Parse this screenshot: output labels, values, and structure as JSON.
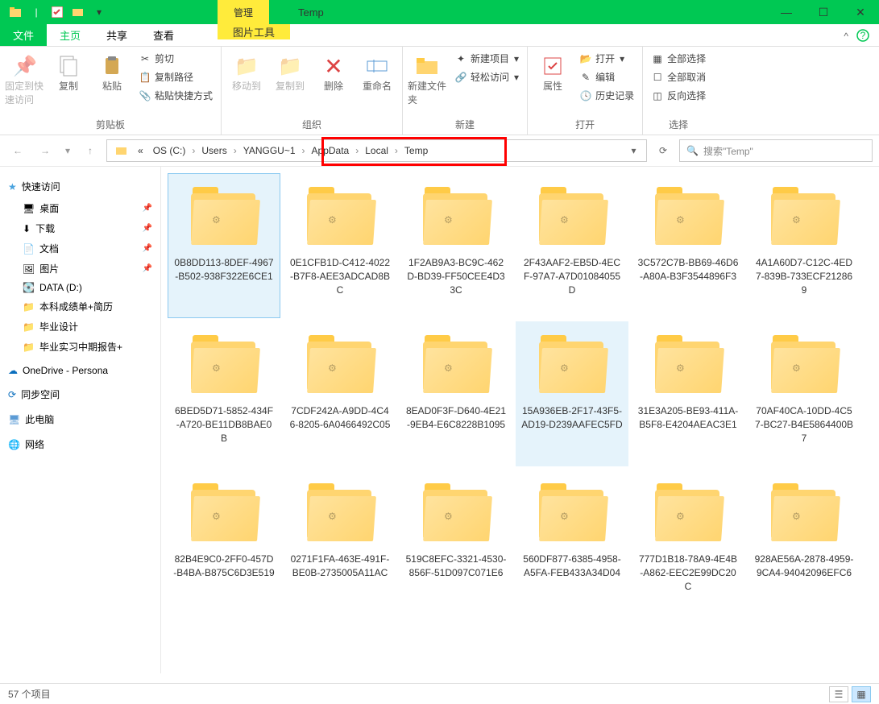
{
  "title": {
    "manage": "管理",
    "window": "Temp"
  },
  "tabs": {
    "file": "文件",
    "home": "主页",
    "share": "共享",
    "view": "查看",
    "pictool": "图片工具"
  },
  "ribbon": {
    "clipboard": {
      "pin": "固定到快速访问",
      "copy": "复制",
      "paste": "粘贴",
      "cut": "剪切",
      "copypath": "复制路径",
      "pastesc": "粘贴快捷方式",
      "label": "剪贴板"
    },
    "organize": {
      "moveto": "移动到",
      "copyto": "复制到",
      "delete": "删除",
      "rename": "重命名",
      "label": "组织"
    },
    "new": {
      "newfolder": "新建文件夹",
      "newitem": "新建项目",
      "easyaccess": "轻松访问",
      "label": "新建"
    },
    "open": {
      "properties": "属性",
      "open": "打开",
      "edit": "编辑",
      "history": "历史记录",
      "label": "打开"
    },
    "select": {
      "selectall": "全部选择",
      "selectnone": "全部取消",
      "invert": "反向选择",
      "label": "选择"
    }
  },
  "breadcrumbs": [
    "OS (C:)",
    "Users",
    "YANGGU~1",
    "AppData",
    "Local",
    "Temp"
  ],
  "search": {
    "placeholder": "搜索\"Temp\""
  },
  "nav": {
    "quick": "快速访问",
    "items": [
      {
        "label": "桌面",
        "pin": true
      },
      {
        "label": "下载",
        "pin": true
      },
      {
        "label": "文档",
        "pin": true
      },
      {
        "label": "图片",
        "pin": true
      },
      {
        "label": "DATA (D:)"
      },
      {
        "label": "本科成绩单+简历"
      },
      {
        "label": "毕业设计"
      },
      {
        "label": "毕业实习中期报告+"
      }
    ],
    "onedrive": "OneDrive - Persona",
    "sync": "同步空间",
    "pc": "此电脑",
    "network": "网络"
  },
  "folders": [
    {
      "name": "0B8DD113-8DEF-4967-B502-938F322E6CE1",
      "sel": true
    },
    {
      "name": "0E1CFB1D-C412-4022-B7F8-AEE3ADCAD8BC"
    },
    {
      "name": "1F2AB9A3-BC9C-462D-BD39-FF50CEE4D33C"
    },
    {
      "name": "2F43AAF2-EB5D-4ECF-97A7-A7D01084055D"
    },
    {
      "name": "3C572C7B-BB69-46D6-A80A-B3F3544896F3"
    },
    {
      "name": "4A1A60D7-C12C-4ED7-839B-733ECF212869"
    },
    {
      "name": "6BED5D71-5852-434F-A720-BE11DB8BAE0B"
    },
    {
      "name": "7CDF242A-A9DD-4C46-8205-6A0466492C05"
    },
    {
      "name": "8EAD0F3F-D640-4E21-9EB4-E6C8228B1095"
    },
    {
      "name": "15A936EB-2F17-43F5-AD19-D239AAFEC5FD",
      "hov": true
    },
    {
      "name": "31E3A205-BE93-411A-B5F8-E4204AEAC3E1"
    },
    {
      "name": "70AF40CA-10DD-4C57-BC27-B4E5864400B7"
    },
    {
      "name": "82B4E9C0-2FF0-457D-B4BA-B875C6D3E519"
    },
    {
      "name": "0271F1FA-463E-491F-BE0B-2735005A11AC"
    },
    {
      "name": "519C8EFC-3321-4530-856F-51D097C071E6"
    },
    {
      "name": "560DF877-6385-4958-A5FA-FEB433A34D04"
    },
    {
      "name": "777D1B18-78A9-4E4B-A862-EEC2E99DC20C"
    },
    {
      "name": "928AE56A-2878-4959-9CA4-94042096EFC6"
    }
  ],
  "status": {
    "count": "57 个项目"
  }
}
